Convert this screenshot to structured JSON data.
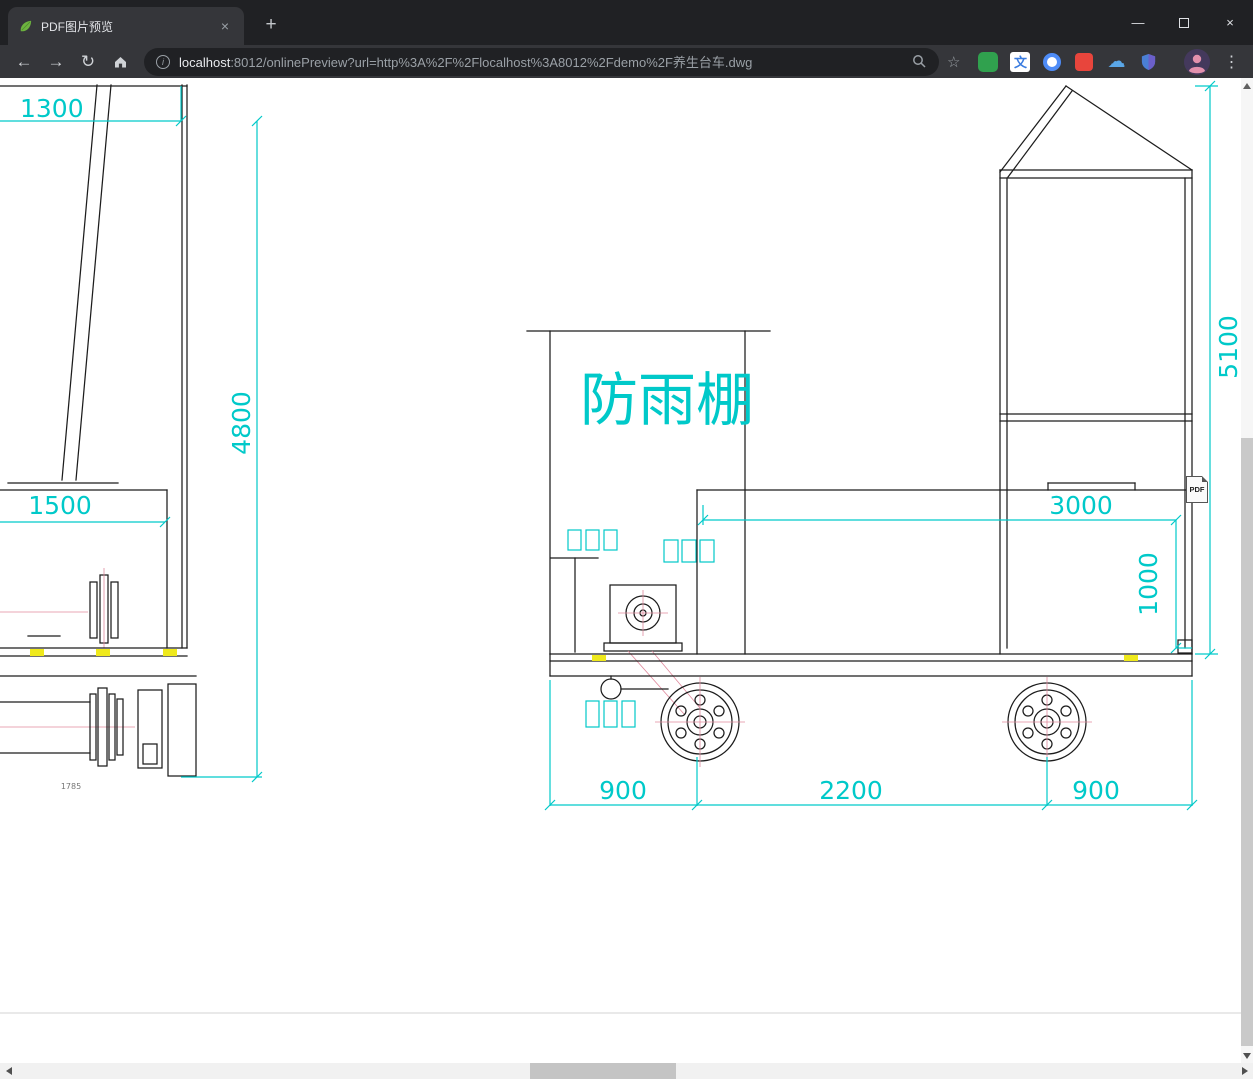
{
  "browser": {
    "tab": {
      "title": "PDF图片预览"
    },
    "address": {
      "host": "localhost",
      "rest": ":8012/onlinePreview?url=http%3A%2F%2Flocalhost%3A8012%2Fdemo%2F养生台车.dwg"
    },
    "icons": {
      "back": "←",
      "forward": "→",
      "reload": "↻",
      "new_tab": "+",
      "tab_close": "×",
      "window_minimize": "—",
      "window_close": "×",
      "info": "i",
      "star": "☆",
      "cloud": "☁",
      "translate": "文",
      "menu": "⋮"
    }
  },
  "drawing": {
    "shelter_label": "防雨棚",
    "pdf_badge": "PDF",
    "dims": {
      "left_top_width": "1300",
      "left_height": "4800",
      "tank_width": "1500",
      "right_height": "5100",
      "body_width": "3000",
      "body_height": "1000",
      "front_overhang": "900",
      "wheelbase": "2200",
      "rear_overhang": "900",
      "base_small": "1785"
    }
  }
}
